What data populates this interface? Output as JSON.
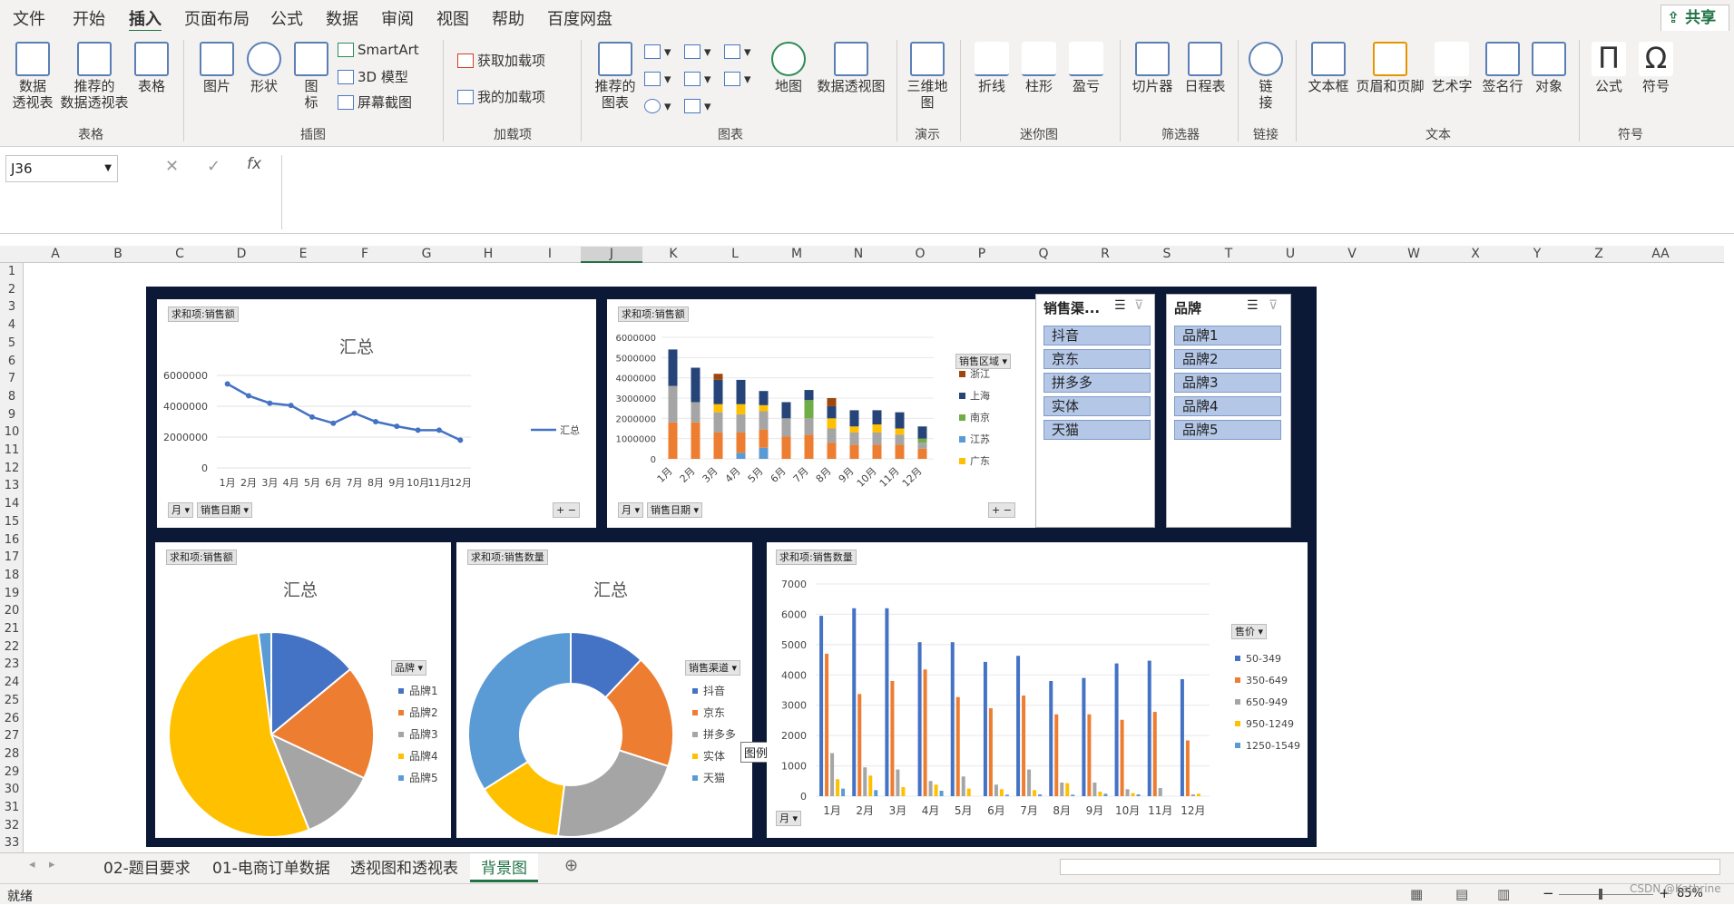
{
  "menu": [
    "文件",
    "开始",
    "插入",
    "页面布局",
    "公式",
    "数据",
    "审阅",
    "视图",
    "帮助",
    "百度网盘"
  ],
  "share_label": "共享",
  "ribbon": {
    "tables": {
      "pivot": "数据\n透视表",
      "recommended": "推荐的\n数据透视表",
      "table": "表格",
      "group": "表格"
    },
    "illus": {
      "picture": "图片",
      "shape": "形状",
      "icon": "图\n标",
      "smartart": "SmartArt",
      "model3d": "3D 模型",
      "screenshot": "屏幕截图",
      "group": "插图"
    },
    "addins": {
      "get": "获取加载项",
      "my": "我的加载项",
      "group": "加载项"
    },
    "charts": {
      "recommended": "推荐的\n图表",
      "map": "地图",
      "pivotchart": "数据透视图",
      "group": "图表"
    },
    "tours": {
      "map3d": "三维地\n图",
      "group": "演示"
    },
    "spark": {
      "line": "折线",
      "column": "柱形",
      "winloss": "盈亏",
      "group": "迷你图"
    },
    "filters": {
      "slicer": "切片器",
      "timeline": "日程表",
      "group": "筛选器"
    },
    "links": {
      "link": "链\n接",
      "group": "链接"
    },
    "text": {
      "textbox": "文本框",
      "header": "页眉和页脚",
      "wordart": "艺术字",
      "signature": "签名行",
      "object": "对象",
      "group": "文本"
    },
    "symbols": {
      "equation": "公式",
      "symbol": "符号",
      "group": "符号"
    }
  },
  "formula": {
    "namebox": "J36",
    "fx": "fx"
  },
  "columns": [
    "A",
    "B",
    "C",
    "D",
    "E",
    "F",
    "G",
    "H",
    "I",
    "J",
    "K",
    "L",
    "M",
    "N",
    "O",
    "P",
    "Q",
    "R",
    "S",
    "T",
    "U",
    "V",
    "W",
    "X",
    "Y",
    "Z",
    "AA"
  ],
  "rows": [
    "1",
    "2",
    "3",
    "4",
    "5",
    "6",
    "7",
    "8",
    "9",
    "10",
    "11",
    "12",
    "13",
    "14",
    "15",
    "16",
    "17",
    "18",
    "19",
    "20",
    "21",
    "22",
    "23",
    "24",
    "25",
    "26",
    "27",
    "28",
    "29",
    "30",
    "31",
    "32",
    "33"
  ],
  "slicers": [
    {
      "title": "销售渠...",
      "items": [
        "抖音",
        "京东",
        "拼多多",
        "实体",
        "天猫"
      ]
    },
    {
      "title": "品牌",
      "items": [
        "品牌1",
        "品牌2",
        "品牌3",
        "品牌4",
        "品牌5"
      ]
    }
  ],
  "chart_data": [
    {
      "type": "line",
      "tag": "求和项:销售额",
      "title": "汇总",
      "legend": "汇总",
      "filters": [
        "月",
        "销售日期"
      ],
      "categories": [
        "1月",
        "2月",
        "3月",
        "4月",
        "5月",
        "6月",
        "7月",
        "8月",
        "9月",
        "10月",
        "11月",
        "12月"
      ],
      "values": [
        5450000,
        4680000,
        4200000,
        4050000,
        3300000,
        2900000,
        3550000,
        3000000,
        2700000,
        2450000,
        2450000,
        1800000
      ],
      "yticks": [
        "0",
        "2000000",
        "4000000",
        "6000000"
      ],
      "ylim": [
        0,
        6000000
      ]
    },
    {
      "type": "bar",
      "stacked": true,
      "tag": "求和项:销售额",
      "legend_title": "销售区域",
      "filters": [
        "月",
        "销售日期"
      ],
      "categories": [
        "1月",
        "2月",
        "3月",
        "4月",
        "5月",
        "6月",
        "7月",
        "8月",
        "9月",
        "10月",
        "11月",
        "12月"
      ],
      "yticks": [
        "0",
        "1000000",
        "2000000",
        "3000000",
        "4000000",
        "5000000",
        "6000000"
      ],
      "ylim": [
        0,
        6000000
      ],
      "series": [
        {
          "name": "广东",
          "color": "#ffc000",
          "values": [
            0,
            0,
            0,
            0,
            0,
            0,
            0,
            0,
            0,
            0,
            0,
            0
          ]
        },
        {
          "name": "江苏",
          "color": "#5b9bd5",
          "values": [
            0,
            0,
            0,
            300000,
            550000,
            0,
            0,
            0,
            0,
            0,
            0,
            0
          ]
        },
        {
          "name": "南京",
          "color": "#70ad47",
          "values": [
            0,
            0,
            0,
            0,
            0,
            0,
            0,
            0,
            0,
            0,
            0,
            0
          ]
        },
        {
          "name": "上海",
          "color": "#264478",
          "values": [
            0,
            0,
            0,
            0,
            0,
            0,
            0,
            0,
            0,
            0,
            0,
            0
          ]
        },
        {
          "name": "浙江",
          "color": "#9e480e",
          "values": [
            0,
            0,
            0,
            0,
            0,
            0,
            0,
            0,
            0,
            0,
            0,
            0
          ]
        }
      ],
      "display_segments": [
        [
          [
            "#ed7d31",
            1800000
          ],
          [
            "#a5a5a5",
            1800000
          ],
          [
            "#264478",
            1800000
          ]
        ],
        [
          [
            "#ed7d31",
            1800000
          ],
          [
            "#a5a5a5",
            1000000
          ],
          [
            "#264478",
            1700000
          ]
        ],
        [
          [
            "#ed7d31",
            1300000
          ],
          [
            "#a5a5a5",
            1000000
          ],
          [
            "#ffc000",
            400000
          ],
          [
            "#264478",
            1200000
          ],
          [
            "#9e480e",
            300000
          ]
        ],
        [
          [
            "#5b9bd5",
            300000
          ],
          [
            "#ed7d31",
            1000000
          ],
          [
            "#a5a5a5",
            900000
          ],
          [
            "#ffc000",
            500000
          ],
          [
            "#264478",
            1200000
          ]
        ],
        [
          [
            "#5b9bd5",
            550000
          ],
          [
            "#ed7d31",
            900000
          ],
          [
            "#a5a5a5",
            900000
          ],
          [
            "#ffc000",
            300000
          ],
          [
            "#264478",
            700000
          ]
        ],
        [
          [
            "#ed7d31",
            1100000
          ],
          [
            "#a5a5a5",
            900000
          ],
          [
            "#264478",
            800000
          ]
        ],
        [
          [
            "#ed7d31",
            1200000
          ],
          [
            "#a5a5a5",
            800000
          ],
          [
            "#70ad47",
            900000
          ],
          [
            "#264478",
            500000
          ]
        ],
        [
          [
            "#ed7d31",
            800000
          ],
          [
            "#a5a5a5",
            700000
          ],
          [
            "#ffc000",
            500000
          ],
          [
            "#264478",
            600000
          ],
          [
            "#9e480e",
            400000
          ]
        ],
        [
          [
            "#ed7d31",
            700000
          ],
          [
            "#a5a5a5",
            600000
          ],
          [
            "#ffc000",
            300000
          ],
          [
            "#264478",
            800000
          ]
        ],
        [
          [
            "#ed7d31",
            700000
          ],
          [
            "#a5a5a5",
            600000
          ],
          [
            "#ffc000",
            400000
          ],
          [
            "#264478",
            700000
          ]
        ],
        [
          [
            "#ed7d31",
            700000
          ],
          [
            "#a5a5a5",
            500000
          ],
          [
            "#ffc000",
            300000
          ],
          [
            "#264478",
            800000
          ]
        ],
        [
          [
            "#ed7d31",
            500000
          ],
          [
            "#a5a5a5",
            300000
          ],
          [
            "#70ad47",
            200000
          ],
          [
            "#264478",
            600000
          ]
        ]
      ]
    },
    {
      "type": "pie",
      "tag": "求和项:销售额",
      "title": "汇总",
      "legend_title": "品牌",
      "series": [
        {
          "name": "品牌1",
          "value": 14,
          "color": "#4472c4"
        },
        {
          "name": "品牌2",
          "value": 18,
          "color": "#ed7d31"
        },
        {
          "name": "品牌3",
          "value": 12,
          "color": "#a5a5a5"
        },
        {
          "name": "品牌4",
          "value": 54,
          "color": "#ffc000"
        },
        {
          "name": "品牌5",
          "value": 2,
          "color": "#5b9bd5"
        }
      ]
    },
    {
      "type": "pie",
      "donut": true,
      "tag": "求和项:销售数量",
      "title": "汇总",
      "legend_title": "销售渠道",
      "tooltip": "图例",
      "series": [
        {
          "name": "抖音",
          "value": 12,
          "color": "#4472c4"
        },
        {
          "name": "京东",
          "value": 18,
          "color": "#ed7d31"
        },
        {
          "name": "拼多多",
          "value": 22,
          "color": "#a5a5a5"
        },
        {
          "name": "实体",
          "value": 14,
          "color": "#ffc000"
        },
        {
          "name": "天猫",
          "value": 34,
          "color": "#5b9bd5"
        }
      ]
    },
    {
      "type": "bar",
      "tag": "求和项:销售数量",
      "legend_title": "售价",
      "filters": [
        "月"
      ],
      "categories": [
        "1月",
        "2月",
        "3月",
        "4月",
        "5月",
        "6月",
        "7月",
        "8月",
        "9月",
        "10月",
        "11月",
        "12月"
      ],
      "yticks": [
        "0",
        "1000",
        "2000",
        "3000",
        "4000",
        "5000",
        "6000",
        "7000"
      ],
      "ylim": [
        0,
        7000
      ],
      "series": [
        {
          "name": "50-349",
          "color": "#4472c4",
          "values": [
            5950,
            6200,
            6200,
            5080,
            5080,
            4430,
            4630,
            3800,
            3900,
            4380,
            4470,
            3860
          ]
        },
        {
          "name": "350-649",
          "color": "#ed7d31",
          "values": [
            4700,
            3370,
            3800,
            4180,
            3270,
            2900,
            3320,
            2700,
            2700,
            2520,
            2780,
            1840
          ]
        },
        {
          "name": "650-949",
          "color": "#a5a5a5",
          "values": [
            1420,
            950,
            880,
            500,
            650,
            380,
            880,
            450,
            450,
            230,
            270,
            60
          ]
        },
        {
          "name": "950-1249",
          "color": "#ffc000",
          "values": [
            560,
            680,
            300,
            380,
            250,
            230,
            200,
            430,
            150,
            100,
            0,
            80
          ]
        },
        {
          "name": "1250-1549",
          "color": "#5b9bd5",
          "values": [
            250,
            200,
            0,
            180,
            0,
            50,
            60,
            50,
            80,
            60,
            0,
            0
          ]
        }
      ]
    }
  ],
  "sheet_tabs": [
    "02-题目要求",
    "01-电商订单数据",
    "透视图和透视表",
    "背景图"
  ],
  "status": {
    "ready": "就绪",
    "zoom": "85%",
    "watermark": "CSDN @Kathrine"
  }
}
